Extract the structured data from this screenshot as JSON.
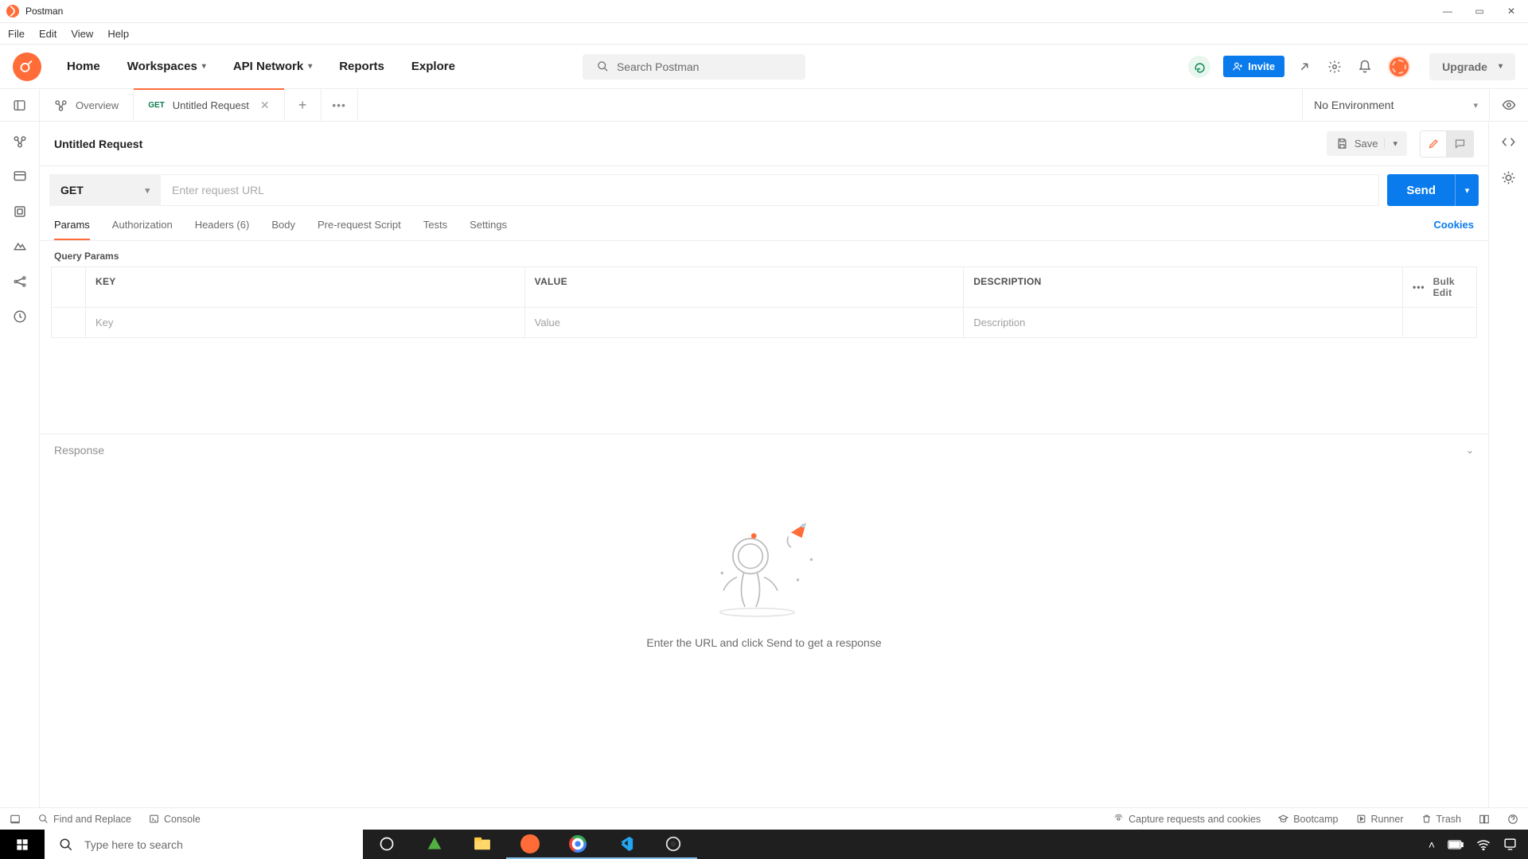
{
  "app": {
    "title": "Postman"
  },
  "menubar": [
    "File",
    "Edit",
    "View",
    "Help"
  ],
  "header": {
    "nav": {
      "home": "Home",
      "workspaces": "Workspaces",
      "api_network": "API Network",
      "reports": "Reports",
      "explore": "Explore"
    },
    "search_placeholder": "Search Postman",
    "invite": "Invite",
    "upgrade": "Upgrade"
  },
  "tabs": {
    "overview": "Overview",
    "untitled": {
      "method": "GET",
      "label": "Untitled Request"
    }
  },
  "environment": {
    "selected": "No Environment"
  },
  "request": {
    "title": "Untitled Request",
    "save": "Save",
    "method": "GET",
    "url_value": "",
    "url_placeholder": "Enter request URL",
    "send": "Send",
    "tab_labels": {
      "params": "Params",
      "authorization": "Authorization",
      "headers": "Headers (6)",
      "body": "Body",
      "prerequest": "Pre-request Script",
      "tests": "Tests",
      "settings": "Settings"
    },
    "cookies": "Cookies",
    "query_params_title": "Query Params",
    "table_headers": {
      "key": "KEY",
      "value": "VALUE",
      "description": "DESCRIPTION"
    },
    "placeholders": {
      "key": "Key",
      "value": "Value",
      "description": "Description"
    },
    "bulk_edit": "Bulk Edit",
    "response_label": "Response",
    "response_hint": "Enter the URL and click Send to get a response"
  },
  "statusbar": {
    "find_replace": "Find and Replace",
    "console": "Console",
    "capture": "Capture requests and cookies",
    "bootcamp": "Bootcamp",
    "runner": "Runner",
    "trash": "Trash"
  },
  "taskbar": {
    "search_placeholder": "Type here to search"
  }
}
